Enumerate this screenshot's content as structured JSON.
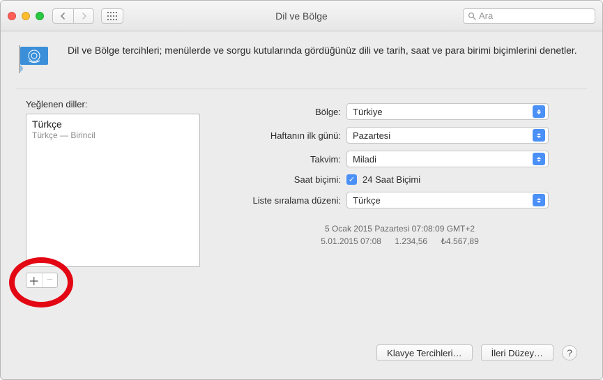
{
  "window": {
    "title": "Dil ve Bölge"
  },
  "toolbar": {
    "search_placeholder": "Ara"
  },
  "header": {
    "description": "Dil ve Bölge tercihleri; menülerde ve sorgu kutularında gördüğünüz dili ve tarih, saat ve para birimi biçimlerini denetler."
  },
  "left": {
    "label": "Yeğlenen diller:",
    "languages": [
      {
        "name": "Türkçe",
        "subtitle": "Türkçe — Birincil"
      }
    ]
  },
  "form": {
    "region_label": "Bölge:",
    "region_value": "Türkiye",
    "weekstart_label": "Haftanın ilk günü:",
    "weekstart_value": "Pazartesi",
    "calendar_label": "Takvim:",
    "calendar_value": "Miladi",
    "timefmt_label": "Saat biçimi:",
    "timefmt_checkbox_label": "24 Saat Biçimi",
    "sortorder_label": "Liste sıralama düzeni:",
    "sortorder_value": "Türkçe"
  },
  "sample": {
    "line1": "5 Ocak 2015 Pazartesi 07:08:09 GMT+2",
    "date2": "5.01.2015 07:08",
    "num": "1.234,56",
    "currency": "₺4.567,89"
  },
  "buttons": {
    "keyboard": "Klavye Tercihleri…",
    "advanced": "İleri Düzey…",
    "help": "?"
  }
}
